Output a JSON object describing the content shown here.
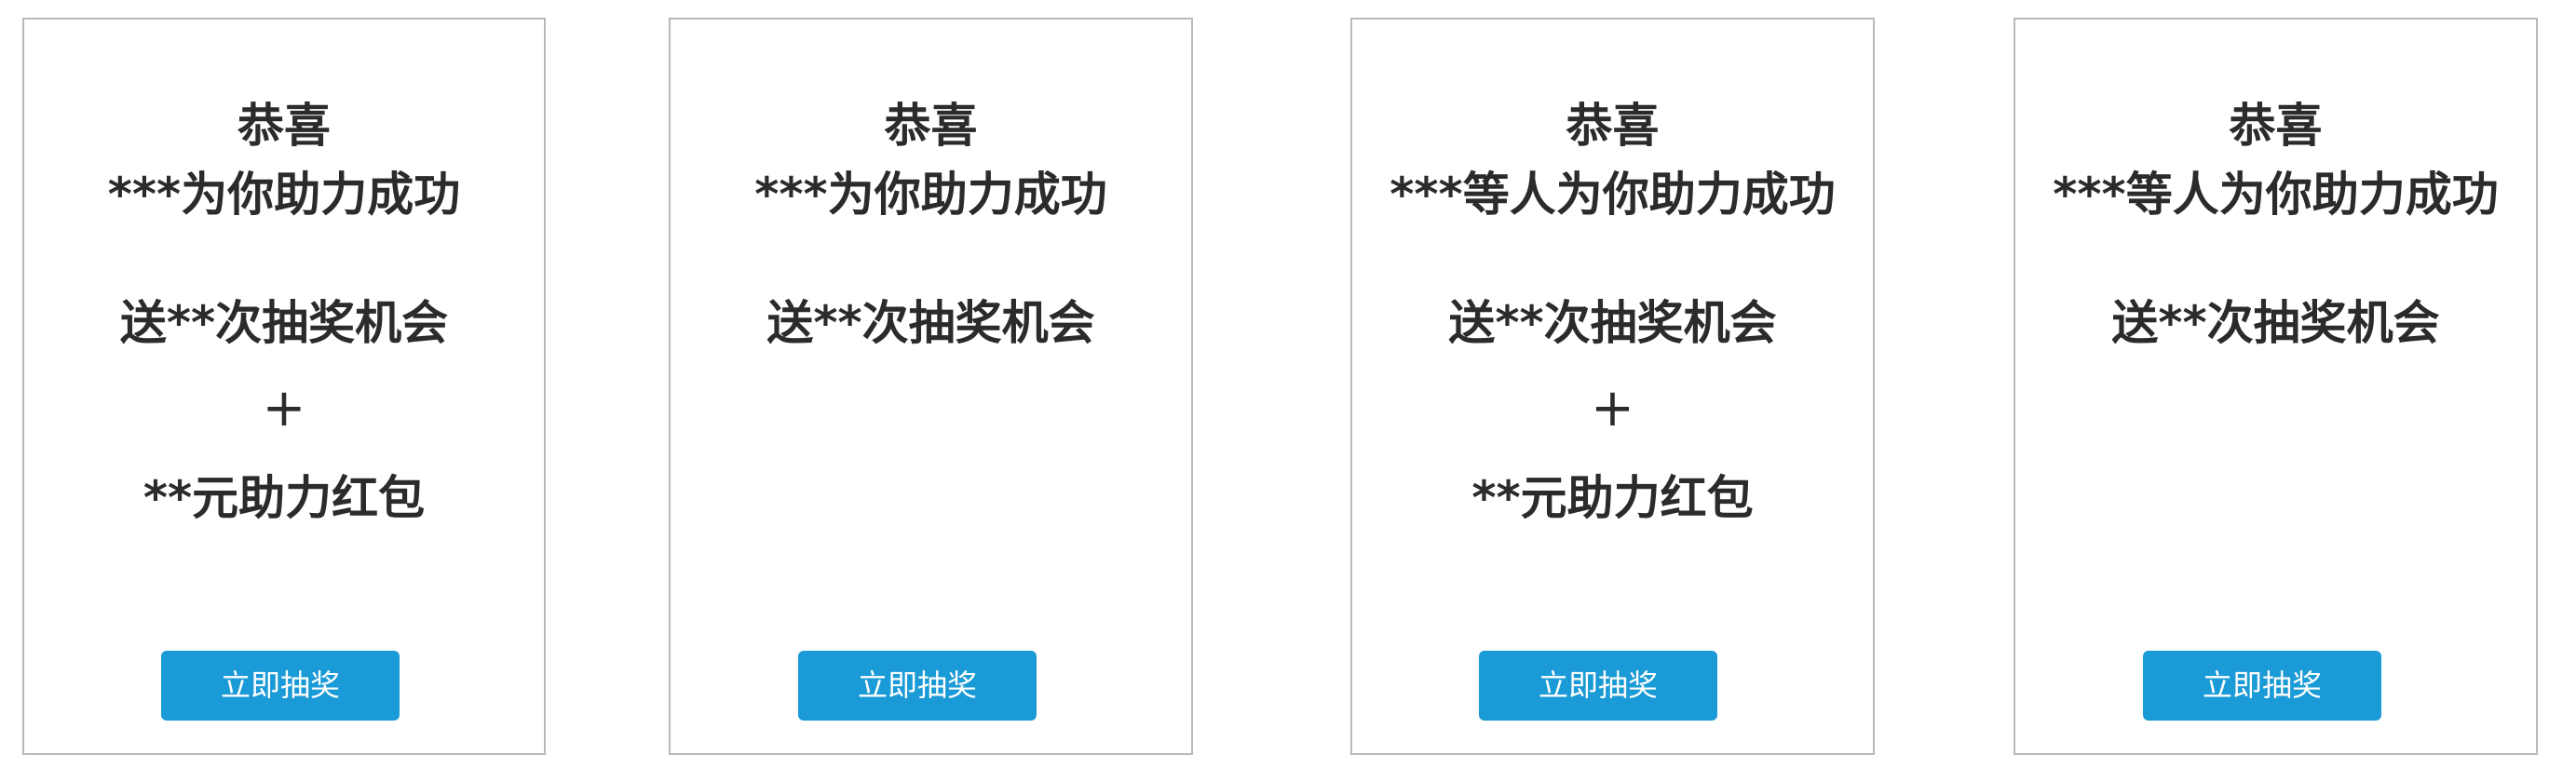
{
  "colors": {
    "button_bg": "#1a9ad6",
    "button_text": "#ffffff",
    "text": "#2b2b2b",
    "card_border": "#b9b9b9"
  },
  "cards": [
    {
      "title": "恭喜",
      "helper_line": "***为你助力成功",
      "chances_line": "送**次抽奖机会",
      "plus": "+",
      "red_packet_line": "**元助力红包",
      "button_label": "立即抽奖"
    },
    {
      "title": "恭喜",
      "helper_line": "***为你助力成功",
      "chances_line": "送**次抽奖机会",
      "button_label": "立即抽奖"
    },
    {
      "title": "恭喜",
      "helper_line": "***等人为你助力成功",
      "chances_line": "送**次抽奖机会",
      "plus": "+",
      "red_packet_line": "**元助力红包",
      "button_label": "立即抽奖"
    },
    {
      "title": "恭喜",
      "helper_line": "***等人为你助力成功",
      "chances_line": "送**次抽奖机会",
      "button_label": "立即抽奖"
    }
  ]
}
